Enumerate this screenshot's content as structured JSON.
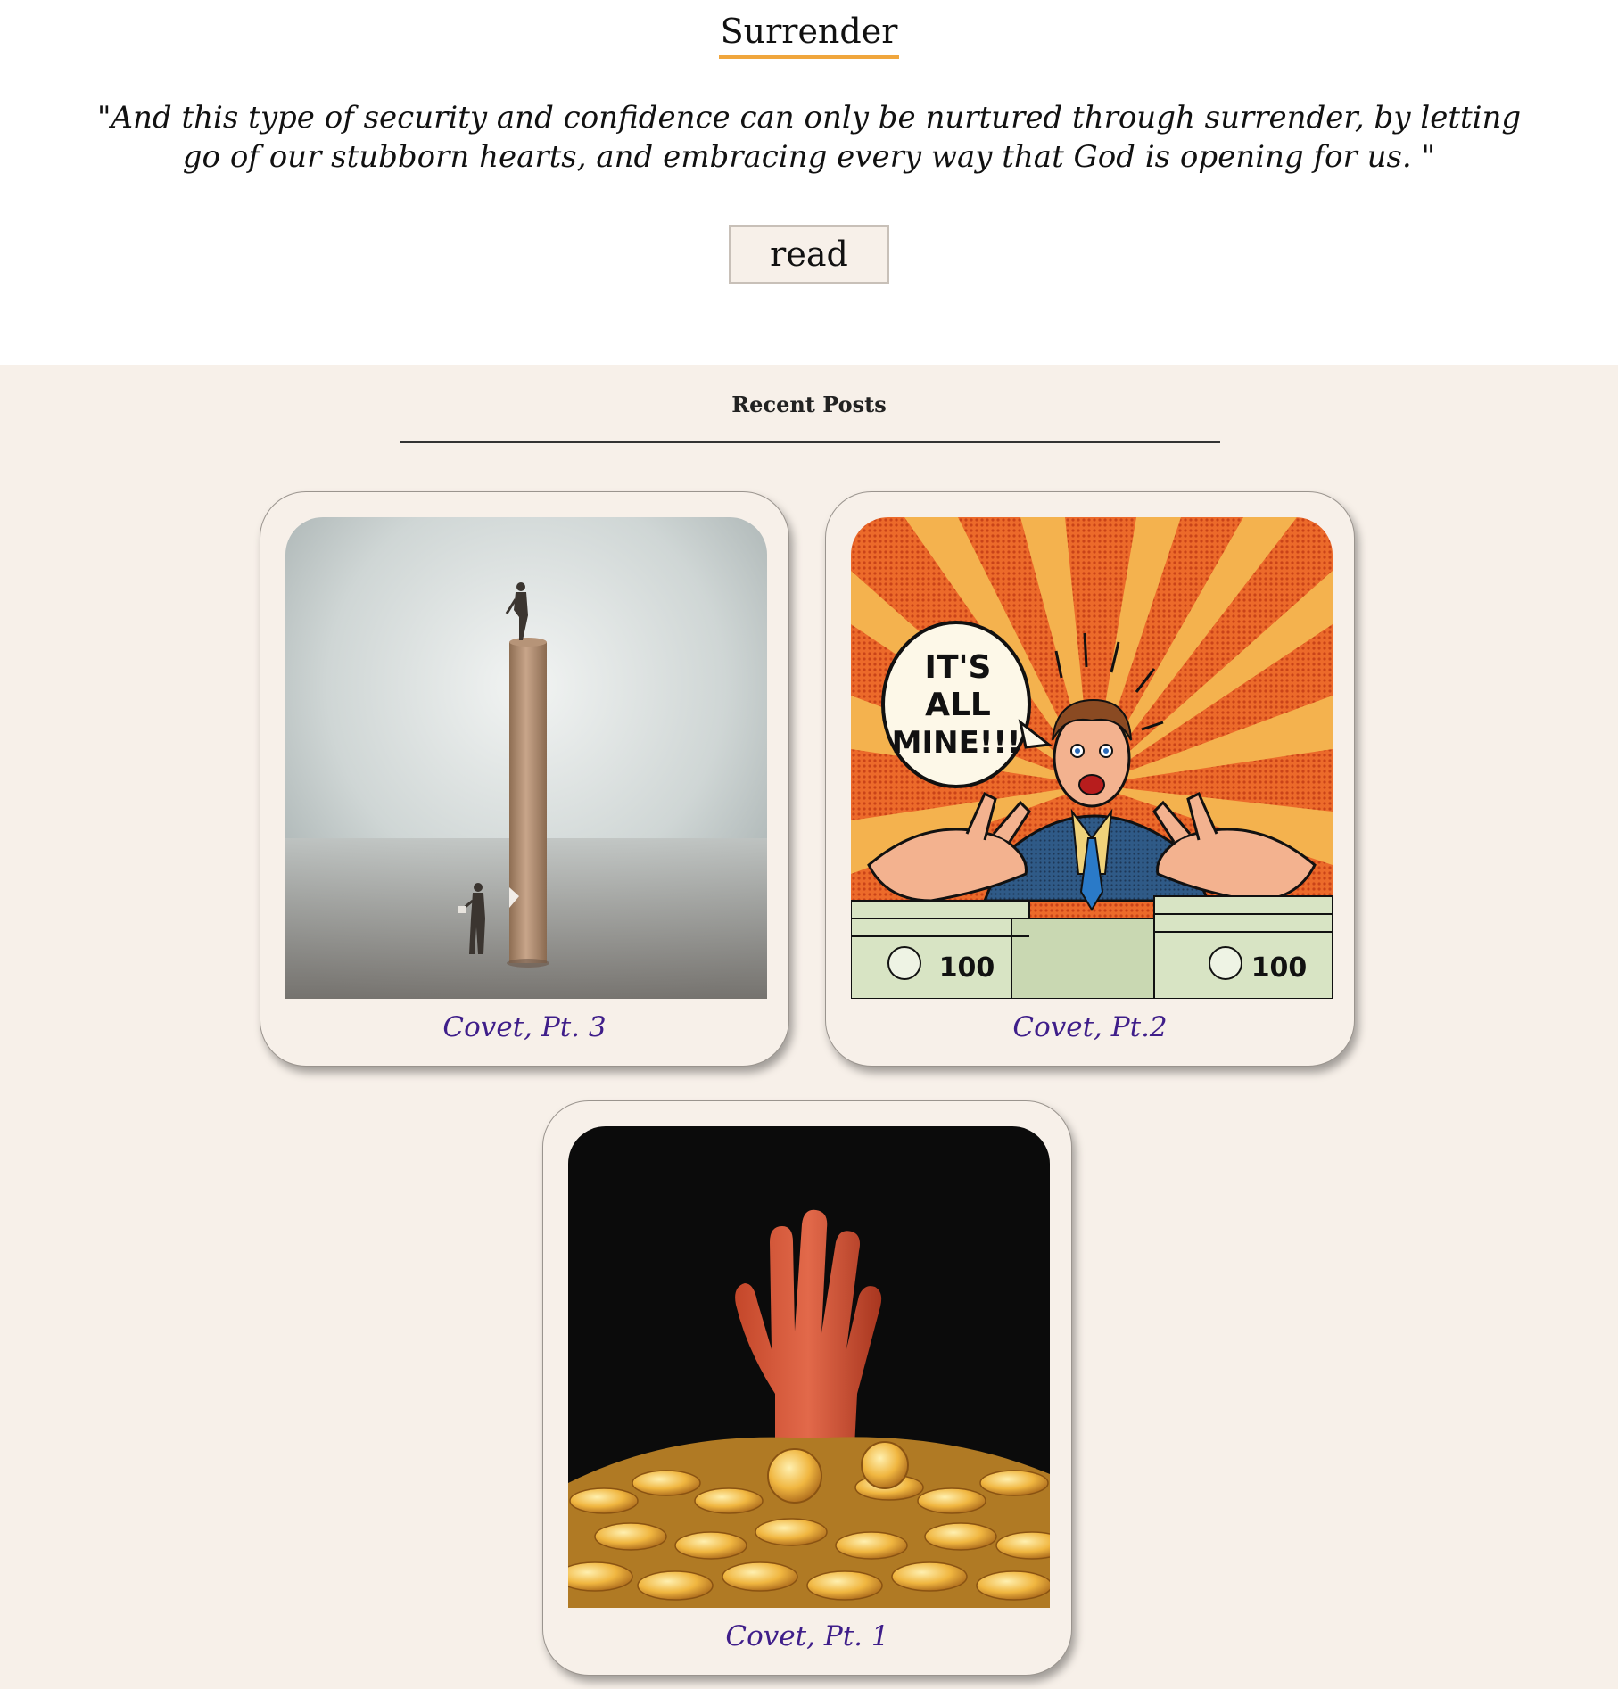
{
  "featured": {
    "title": "Surrender",
    "quote": "\"And this type of security and confidence can only be nurtured through surrender, by letting go of our stubborn hearts, and embracing every way that God is opening for us. \"",
    "read_label": "read"
  },
  "recent": {
    "heading": "Recent Posts",
    "posts": [
      {
        "title": "Covet, Pt. 3"
      },
      {
        "title": "Covet, Pt.2"
      },
      {
        "title": "Covet, Pt. 1"
      }
    ],
    "speech_bubble": [
      "IT'S",
      "ALL",
      "MINE!!!"
    ],
    "money_label": "100"
  },
  "colors": {
    "title_underline": "#f0a63d",
    "post_title": "#3f1e8a",
    "section_bg": "#f7f0e9"
  }
}
